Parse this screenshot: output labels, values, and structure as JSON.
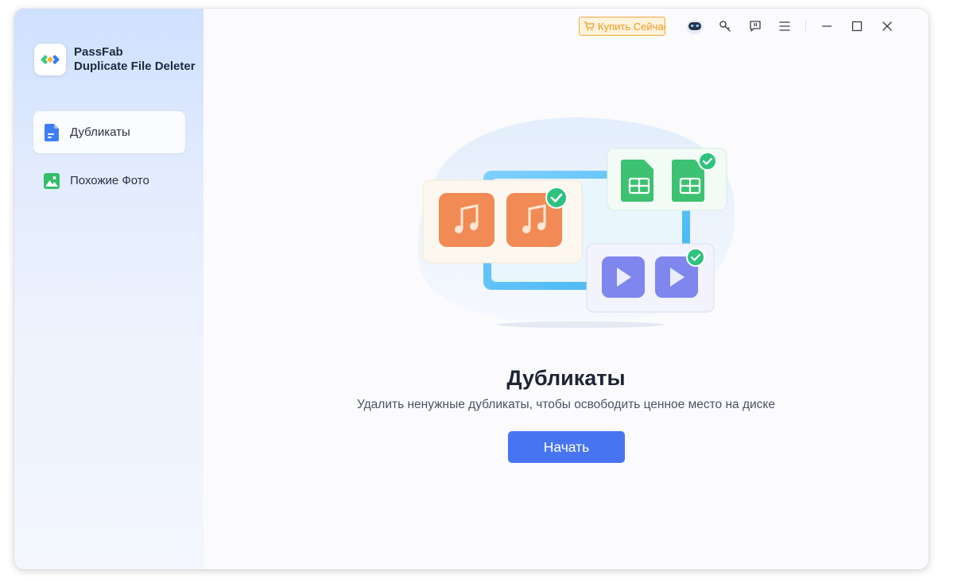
{
  "app": {
    "brand_line1": "PassFab",
    "brand_line2": "Duplicate File Deleter"
  },
  "sidebar": {
    "items": [
      {
        "label": "Дубликаты",
        "icon": "document-icon",
        "active": true
      },
      {
        "label": "Похожие Фото",
        "icon": "image-icon",
        "active": false
      }
    ]
  },
  "topbar": {
    "buy_label": "Купить Сейчас",
    "icons": [
      "cart-icon",
      "robot-icon",
      "key-icon",
      "feedback-icon",
      "menu-icon",
      "minimize-icon",
      "maximize-icon",
      "close-icon"
    ]
  },
  "main": {
    "title": "Дубликаты",
    "subtitle": "Удалить ненужные дубликаты, чтобы освободить ценное место на диске",
    "start_label": "Начать"
  },
  "colors": {
    "accent": "#4774f0",
    "buy_border": "#f2a93a",
    "buy_text": "#ee9b22",
    "music_card": "#f28a55",
    "sheet_card": "#3cc270",
    "video_card": "#7f86ee",
    "check": "#2ec27e"
  }
}
